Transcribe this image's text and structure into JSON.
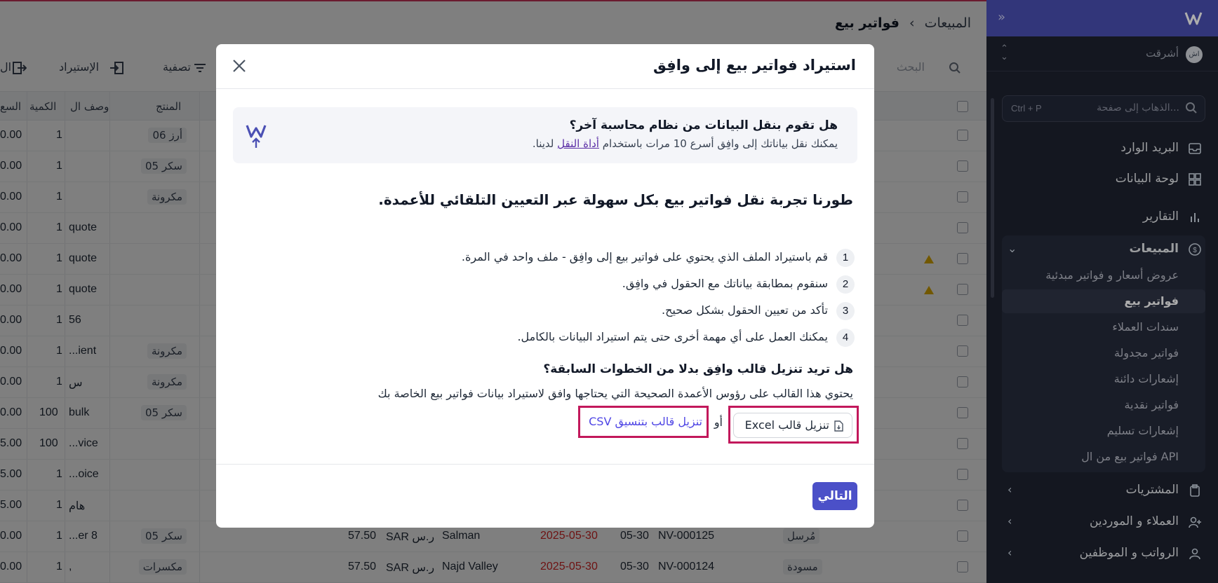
{
  "sidebar": {
    "company": "أشرقت",
    "avatar_text": "اش",
    "search_placeholder": "الذهاب إلى صفحة...",
    "search_shortcut": "Ctrl + P",
    "items": [
      {
        "label": "البريد الوارد",
        "icon": "inbox-icon"
      },
      {
        "label": "لوحة البيانات",
        "icon": "dashboard-icon"
      },
      {
        "label": "التقارير",
        "icon": "reports-icon"
      },
      {
        "label": "المبيعات",
        "icon": "sales-icon"
      }
    ],
    "sales_subitems": [
      {
        "label": "عروض أسعار و فواتير مبدئية"
      },
      {
        "label": "فواتير بيع",
        "active": true
      },
      {
        "label": "سندات العملاء"
      },
      {
        "label": "فواتير مجدولة"
      },
      {
        "label": "إشعارات دائنة"
      },
      {
        "label": "فواتير نقدية"
      },
      {
        "label": "إشعارات تسليم"
      },
      {
        "label": "فواتير بيع من ال API"
      }
    ],
    "bottom_items": [
      {
        "label": "المشتريات",
        "icon": "purchases-icon"
      },
      {
        "label": "العملاء و الموردين",
        "icon": "contacts-icon"
      },
      {
        "label": "الرواتب و الموظفين",
        "icon": "payroll-icon"
      }
    ]
  },
  "main": {
    "breadcrumb": {
      "parent": "المبيعات",
      "current": "فواتير بيع"
    },
    "toolbar": {
      "search": "البحث",
      "filter": "تصفية",
      "import": "الإستيراد",
      "export": "ال"
    },
    "columns": {
      "product": "المنتج",
      "description": "وصف ال",
      "quantity": "الكمية",
      "price": "السع"
    },
    "rows": [
      {
        "price": "0.00",
        "qty": "1",
        "desc": "",
        "product": "06 أرز"
      },
      {
        "price": "0.00",
        "qty": "1",
        "desc": "",
        "product": "05 سكر"
      },
      {
        "price": "0.00",
        "qty": "1",
        "desc": "",
        "product": "مكرونة"
      },
      {
        "price": "0.00",
        "qty": "1",
        "desc": "quote",
        "product": ""
      },
      {
        "price": "0.00",
        "qty": "1",
        "desc": "quote",
        "product": ""
      },
      {
        "price": "0.00",
        "qty": "1",
        "desc": "quote",
        "product": ""
      },
      {
        "price": "0.00",
        "qty": "1",
        "desc": "56",
        "product": ""
      },
      {
        "price": "0.00",
        "qty": "1",
        "desc": "...ient",
        "product": "مكرونة"
      },
      {
        "price": "0.00",
        "qty": "1",
        "desc": "س",
        "product": "مكرونة"
      },
      {
        "price": "0.00",
        "qty": "100",
        "desc": "bulk",
        "product": "05 سكر"
      },
      {
        "price": "5.00",
        "qty": "100",
        "desc": "...vice",
        "product": ""
      },
      {
        "price": "5.00",
        "qty": "1",
        "desc": "...oice",
        "product": ""
      },
      {
        "price": "5.00",
        "qty": "1",
        "desc": "هام",
        "product": ""
      },
      {
        "price": "0.00",
        "qty": "1",
        "desc": "...er 8",
        "product": "05 سكر",
        "amount": "57.50",
        "currency": "SAR ر.س",
        "customer": "Salman",
        "date": "2025-05-30",
        "due": "05-30",
        "number": "NV-000125",
        "status": "مُرسل"
      },
      {
        "price": "0.00",
        "qty": "1",
        "desc": ",",
        "product": "مكسرات",
        "amount": "57.50",
        "currency": "SAR ر.س",
        "customer": "Najd Valley",
        "date": "2025-05-30",
        "due": "05-30",
        "number": "NV-000124",
        "status": "مسودة"
      }
    ],
    "warning_color": "#e5b100",
    "accent": "#4b50c8"
  },
  "modal": {
    "title": "استيراد فواتير بيع إلى وافِق",
    "banner_question": "هل تقوم بنقل البيانات من نظام محاسبة آخر؟",
    "banner_text_before": "يمكنك نقل بياناتك إلى وافِق أسرع 10 مرات باستخدام ",
    "banner_link": "أداة النقل",
    "banner_text_after": " لدينا.",
    "heading": "طورنا تجربة نقل فواتير بيع بكل سهولة عبر التعيين التلقائي للأعمدة.",
    "steps": [
      {
        "num": "1",
        "text": "قم باستيراد الملف الذي يحتوي على فواتير بيع إلى وافِق - ملف واحد في المرة."
      },
      {
        "num": "2",
        "text": "سنقوم بمطابقة بياناتك مع الحقول في وافِق."
      },
      {
        "num": "3",
        "text": "تأكد من تعيين الحقول بشكل صحيح."
      },
      {
        "num": "4",
        "text": "يمكنك العمل على أي مهمة أخرى حتى يتم استيراد البيانات بالكامل."
      }
    ],
    "template_question": "هل تريد تنزيل قالب وافِق بدلا من الخطوات السابقة؟",
    "template_desc": "يحتوي هذا القالب على رؤوس الأعمدة الصحيحة التي يحتاجها وافق لاستيراد بيانات فواتير بيع الخاصة بك",
    "excel_label": "تنزيل قالب Excel",
    "or_label": "أو",
    "csv_label": "تنزيل قالب بتنسيق CSV",
    "next_label": "التالي",
    "highlight_color": "#c2185b"
  }
}
